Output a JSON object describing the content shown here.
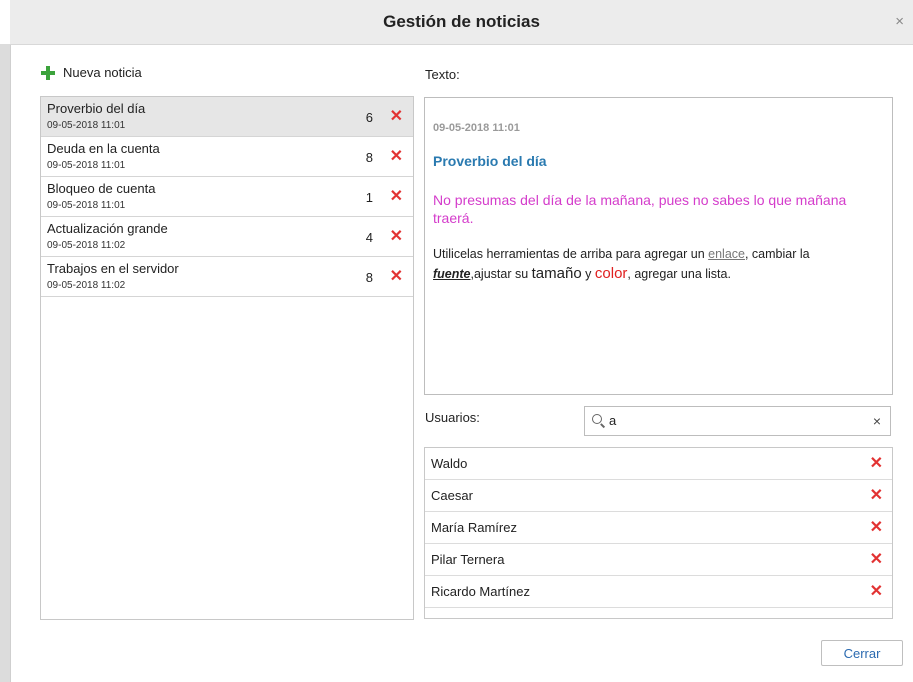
{
  "dialog": {
    "title": "Gestión de noticias",
    "close_glyph": "×",
    "new_news_label": "Nueva noticia"
  },
  "news": [
    {
      "title": "Proverbio del día",
      "date": "09-05-2018 11:01",
      "count": "6",
      "selected": true
    },
    {
      "title": "Deuda en la cuenta",
      "date": "09-05-2018 11:01",
      "count": "8",
      "selected": false
    },
    {
      "title": "Bloqueo de cuenta",
      "date": "09-05-2018 11:01",
      "count": "1",
      "selected": false
    },
    {
      "title": "Actualización grande",
      "date": "09-05-2018 11:02",
      "count": "4",
      "selected": false
    },
    {
      "title": "Trabajos en el servidor",
      "date": "09-05-2018 11:02",
      "count": "8",
      "selected": false
    }
  ],
  "delete_glyph": "✕",
  "texto": {
    "label": "Texto:",
    "date": "09-05-2018 11:01",
    "title": "Proverbio del día",
    "quote": "No presumas del día de la mañana, pues no sabes lo que mañana traerá.",
    "body": {
      "p1": "Utilicelas herramientas de arriba para agregar un ",
      "link": "enlace",
      "p2": ", cambiar la ",
      "fuente": "fuente",
      "p3": ",ajustar su ",
      "tamano": "tamaño",
      "p4": " y ",
      "color": "color",
      "p5": ", agregar una lista."
    }
  },
  "usuarios": {
    "label": "Usuarios:",
    "search_value": "a",
    "clear_glyph": "×",
    "users": [
      "Waldo",
      "Caesar",
      "María Ramírez",
      "Pilar Ternera",
      "Ricardo Martínez"
    ]
  },
  "footer": {
    "close_label": "Cerrar"
  },
  "colors": {
    "add_green": "#3ca33c",
    "delete_red": "#e23232",
    "title_blue": "#2a7ab0",
    "quote_magenta": "#d43ccb",
    "color_red": "#e02020"
  }
}
